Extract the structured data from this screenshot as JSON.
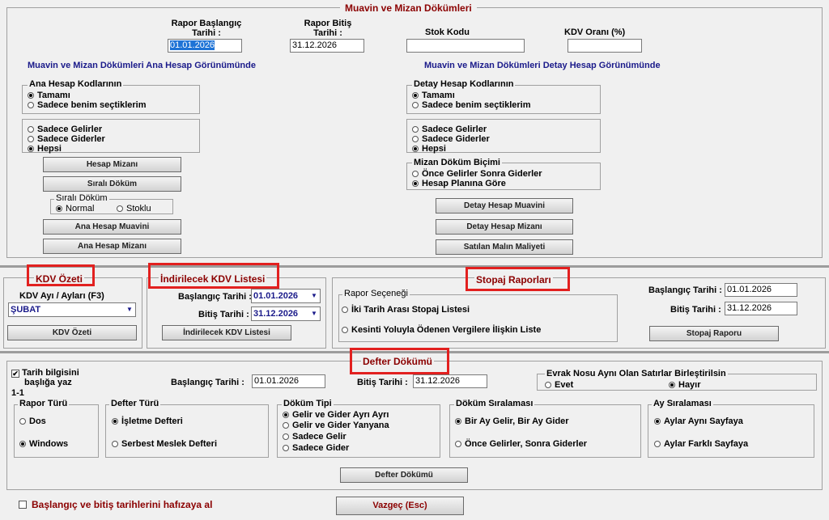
{
  "muavin": {
    "title": "Muavin ve Mizan Dökümleri",
    "start_label_1": "Rapor Başlangıç",
    "start_label_2": "Tarihi :",
    "start_value": "01.01.2026",
    "end_label_1": "Rapor Bitiş",
    "end_label_2": "Tarihi :",
    "end_value": "31.12.2026",
    "stok_label": "Stok Kodu",
    "kdv_rate_label": "KDV Oranı (%)",
    "left_heading": "Muavin ve Mizan Dökümleri Ana Hesap Görünümünde",
    "right_heading": "Muavin ve Mizan Dökümleri Detay Hesap Görünümünde",
    "ana_group_title": "Ana Hesap Kodlarının",
    "ana_opt1": "Tamamı",
    "ana_opt2": "Sadece benim seçtiklerim",
    "gelir_opt1": "Sadece Gelirler",
    "gelir_opt2": "Sadece Giderler",
    "gelir_opt3": "Hepsi",
    "btn_hesap_mizani": "Hesap Mizanı",
    "btn_sirali_dokum": "Sıralı Döküm",
    "sirali_group_title": "Sıralı Döküm",
    "sirali_opt1": "Normal",
    "sirali_opt2": "Stoklu",
    "btn_ana_muavini": "Ana Hesap Muavini",
    "btn_ana_mizani": "Ana Hesap Mizanı",
    "detay_group_title": "Detay Hesap Kodlarının",
    "detay_opt1": "Tamamı",
    "detay_opt2": "Sadece benim seçtiklerim",
    "detay_gelir_opt1": "Sadece Gelirler",
    "detay_gelir_opt2": "Sadece Giderler",
    "detay_gelir_opt3": "Hepsi",
    "bicim_group_title": "Mizan Döküm Biçimi",
    "bicim_opt1": "Önce Gelirler Sonra Giderler",
    "bicim_opt2": "Hesap Planına Göre",
    "btn_detay_muavini": "Detay Hesap Muavini",
    "btn_detay_mizani": "Detay Hesap Mizanı",
    "btn_satilan": "Satılan Malın Maliyeti"
  },
  "kdv": {
    "title": "KDV Özeti",
    "months_label": "KDV Ayı / Ayları (F3)",
    "month_value": "ŞUBAT",
    "btn": "KDV Özeti"
  },
  "indirilecek": {
    "title": "İndirilecek KDV Listesi",
    "start_label": "Başlangıç Tarihi :",
    "start_value": "01.01.2026",
    "end_label": "Bitiş Tarihi :",
    "end_value": "31.12.2026",
    "btn": "İndirilecek KDV Listesi"
  },
  "stopaj": {
    "title": "Stopaj Raporları",
    "group_title": "Rapor Seçeneği",
    "opt1": "İki Tarih Arası Stopaj Listesi",
    "opt2": "Kesinti Yoluyla Ödenen Vergilere İlişkin Liste",
    "start_label": "Başlangıç Tarihi :",
    "start_value": "01.01.2026",
    "end_label": "Bitiş Tarihi :",
    "end_value": "31.12.2026",
    "btn": "Stopaj Raporu"
  },
  "defter": {
    "title": "Defter Dökümü",
    "tarih_check_1": "Tarih bilgisini",
    "tarih_check_2": "başlığa yaz",
    "page_info": "1-1",
    "start_label": "Başlangıç Tarihi :",
    "start_value": "01.01.2026",
    "end_label": "Bitiş Tarihi :",
    "end_value": "31.12.2026",
    "evrak_title": "Evrak Nosu Aynı Olan Satırlar Birleştirilsin",
    "evrak_opt1": "Evet",
    "evrak_opt2": "Hayır",
    "rapor_turu_title": "Rapor Türü",
    "rapor_opt1": "Dos",
    "rapor_opt2": "Windows",
    "defter_turu_title": "Defter Türü",
    "defter_opt1": "İşletme Defteri",
    "defter_opt2": "Serbest Meslek Defteri",
    "dokum_tipi_title": "Döküm Tipi",
    "tip_opt1": "Gelir ve Gider Ayrı Ayrı",
    "tip_opt2": "Gelir ve Gider Yanyana",
    "tip_opt3": "Sadece Gelir",
    "tip_opt4": "Sadece Gider",
    "siralama_title": "Döküm Sıralaması",
    "siralama_opt1": "Bir Ay Gelir, Bir Ay Gider",
    "siralama_opt2": "Önce Gelirler, Sonra Giderler",
    "ay_title": "Ay Sıralaması",
    "ay_opt1": "Aylar Aynı Sayfaya",
    "ay_opt2": "Aylar Farklı Sayfaya",
    "btn": "Defter Dökümü"
  },
  "footer": {
    "remember_label": "Başlangıç ve bitiş tarihlerini hafızaya al",
    "cancel_btn": "Vazgeç (Esc)"
  },
  "colors": {
    "highlight_box": "#e2201f",
    "title_maroon": "#8b0000",
    "heading_navy": "#1a1a8a"
  }
}
